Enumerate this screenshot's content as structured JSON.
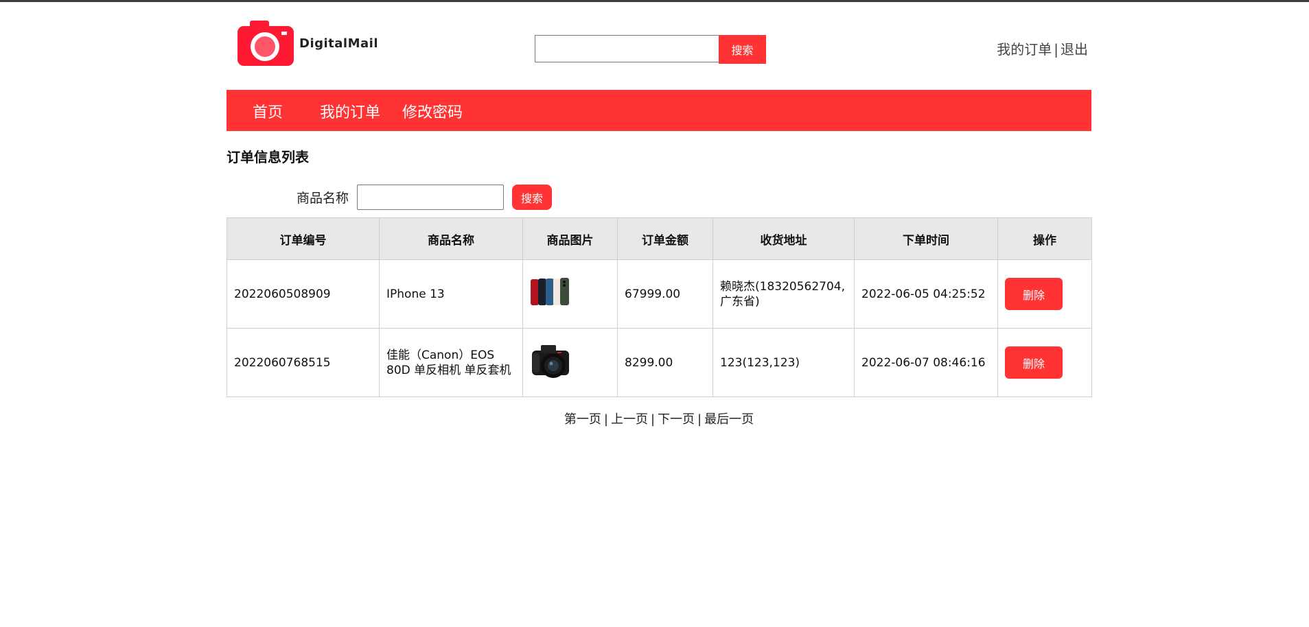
{
  "brand": {
    "logo_text": "DigitalMail",
    "accent": "#ff3333"
  },
  "header": {
    "search": {
      "value": "",
      "placeholder": "",
      "button_label": "搜索"
    },
    "links": [
      {
        "label": "我的订单"
      },
      {
        "label": "退出"
      }
    ],
    "link_separator": "|"
  },
  "nav": {
    "items": [
      {
        "label": "首页"
      },
      {
        "label": "我的订单"
      },
      {
        "label": "修改密码"
      }
    ]
  },
  "page": {
    "title": "订单信息列表",
    "filter": {
      "label": "商品名称",
      "value": "",
      "button_label": "搜索"
    }
  },
  "table": {
    "columns": [
      "订单编号",
      "商品名称",
      "商品图片",
      "订单金额",
      "收货地址",
      "下单时间",
      "操作"
    ],
    "rows": [
      {
        "order_no": "2022060508909",
        "product": "IPhone 13",
        "image": "iphone-13-image",
        "amount": "67999.00",
        "address": "赖晓杰(18320562704,广东省)",
        "time": "2022-06-05 04:25:52",
        "action": "删除"
      },
      {
        "order_no": "2022060768515",
        "product": "佳能（Canon）EOS 80D 单反相机 单反套机",
        "image": "canon-camera-image",
        "amount": "8299.00",
        "address": "123(123,123)",
        "time": "2022-06-07 08:46:16",
        "action": "删除"
      }
    ]
  },
  "pager": {
    "items": [
      {
        "label": "第一页"
      },
      {
        "label": "上一页"
      },
      {
        "label": "下一页"
      },
      {
        "label": "最后一页"
      }
    ],
    "separator": "|"
  }
}
